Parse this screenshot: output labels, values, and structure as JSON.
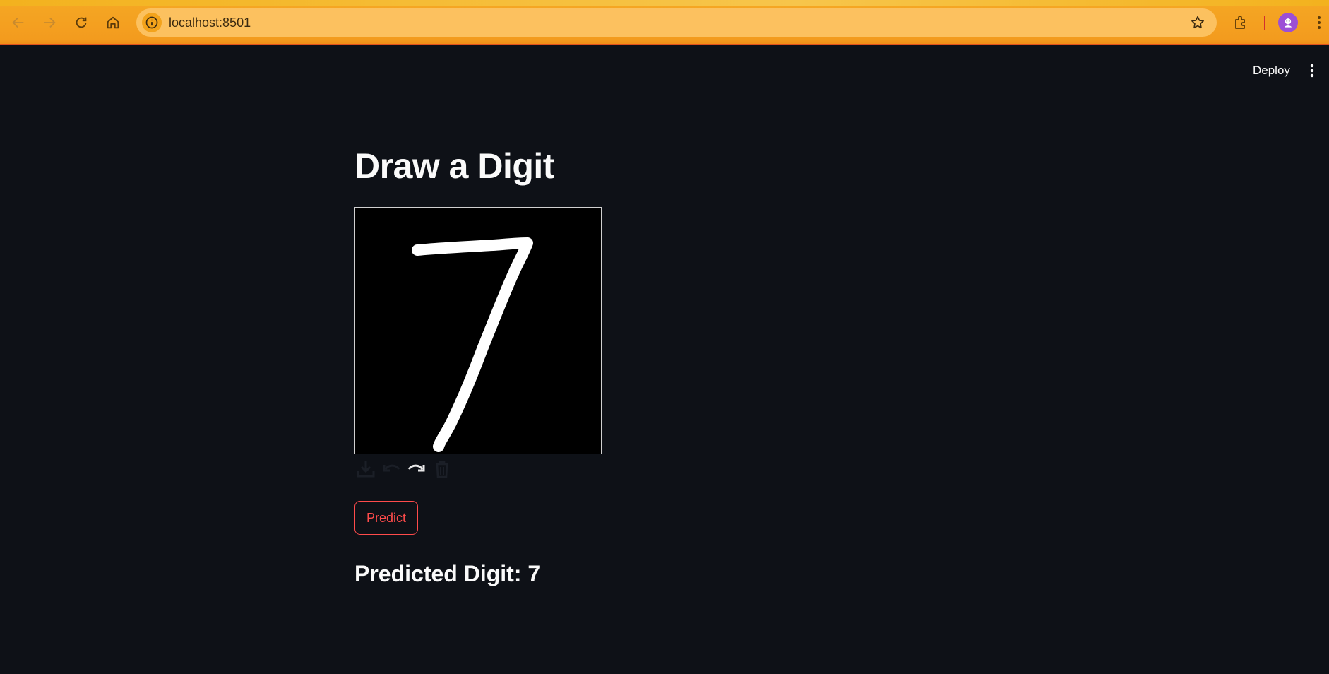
{
  "browser": {
    "url": "localhost:8501",
    "icons": [
      "back-icon",
      "forward-icon",
      "reload-icon",
      "home-icon",
      "site-info-icon",
      "bookmark-star-icon",
      "extensions-icon",
      "profile-avatar",
      "browser-menu-icon"
    ]
  },
  "app": {
    "deploy_label": "Deploy",
    "title": "Draw a Digit",
    "canvas": {
      "background": "#000000",
      "stroke_color": "#ffffff",
      "tools": [
        "download-icon",
        "undo-icon",
        "redo-icon",
        "trash-icon"
      ]
    },
    "predict_label": "Predict",
    "result_text": "Predicted Digit: 7"
  },
  "colors": {
    "app_background": "#0e1117",
    "accent": "#ff4b4b",
    "chrome_orange": "#f5a623"
  }
}
